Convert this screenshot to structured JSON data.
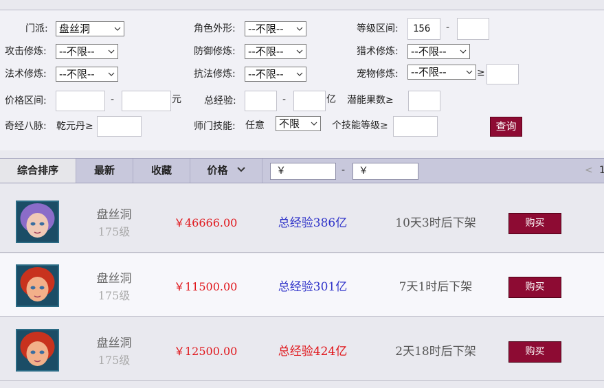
{
  "filters": {
    "school_label": "门派:",
    "school_value": "盘丝洞",
    "appearance_label": "角色外形:",
    "appearance_value": "--不限--",
    "level_range_label": "等级区间:",
    "level_min": "156",
    "level_max": "",
    "attack_label": "攻击修炼:",
    "attack_value": "--不限--",
    "defense_label": "防御修炼:",
    "defense_value": "--不限--",
    "hunting_label": "猎术修炼:",
    "hunting_value": "--不限--",
    "magic_label": "法术修炼:",
    "magic_value": "--不限--",
    "resist_label": "抗法修炼:",
    "resist_value": "--不限--",
    "pet_label": "宠物修炼:",
    "pet_value": "--不限--",
    "pet_ge": "≥",
    "pet_input": "",
    "price_range_label": "价格区间:",
    "price_min": "",
    "price_max": "",
    "price_unit": "元",
    "exp_label": "总经验:",
    "exp_min": "",
    "exp_max": "",
    "exp_unit": "亿",
    "potential_label": "潜能果数≥",
    "potential_value": "",
    "meridian_label": "奇经八脉:",
    "meridian_sub": "乾元丹≥",
    "meridian_value": "",
    "master_skill_label": "师门技能:",
    "master_skill_mode": "任意",
    "master_skill_value": "不限",
    "skill_level_label": "个技能等级≥",
    "skill_level_value": "",
    "dash": "-",
    "query_button": "查询"
  },
  "sortbar": {
    "tabs": [
      "综合排序",
      "最新",
      "收藏",
      "价格"
    ],
    "price_from": "￥",
    "price_to": "￥",
    "dash": "-",
    "pager_prev": "<",
    "pager_page": "1"
  },
  "listings": [
    {
      "school": "盘丝洞",
      "level": "175级",
      "price": "￥46666.00",
      "exp": "总经验386亿",
      "exp_color": "#2f33c9",
      "time_left": "10天3时后下架",
      "buy": "购买",
      "avatar_hair": "#8b6cc9",
      "avatar_skin": "#f0c9b6"
    },
    {
      "school": "盘丝洞",
      "level": "175级",
      "price": "￥11500.00",
      "exp": "总经验301亿",
      "exp_color": "#2f33c9",
      "time_left": "7天1时后下架",
      "buy": "购买",
      "avatar_hair": "#c8321e",
      "avatar_skin": "#f2b08a"
    },
    {
      "school": "盘丝洞",
      "level": "175级",
      "price": "￥12500.00",
      "exp": "总经验424亿",
      "exp_color": "#e0161b",
      "time_left": "2天18时后下架",
      "buy": "购买",
      "avatar_hair": "#c8321e",
      "avatar_skin": "#f2b08a"
    }
  ]
}
